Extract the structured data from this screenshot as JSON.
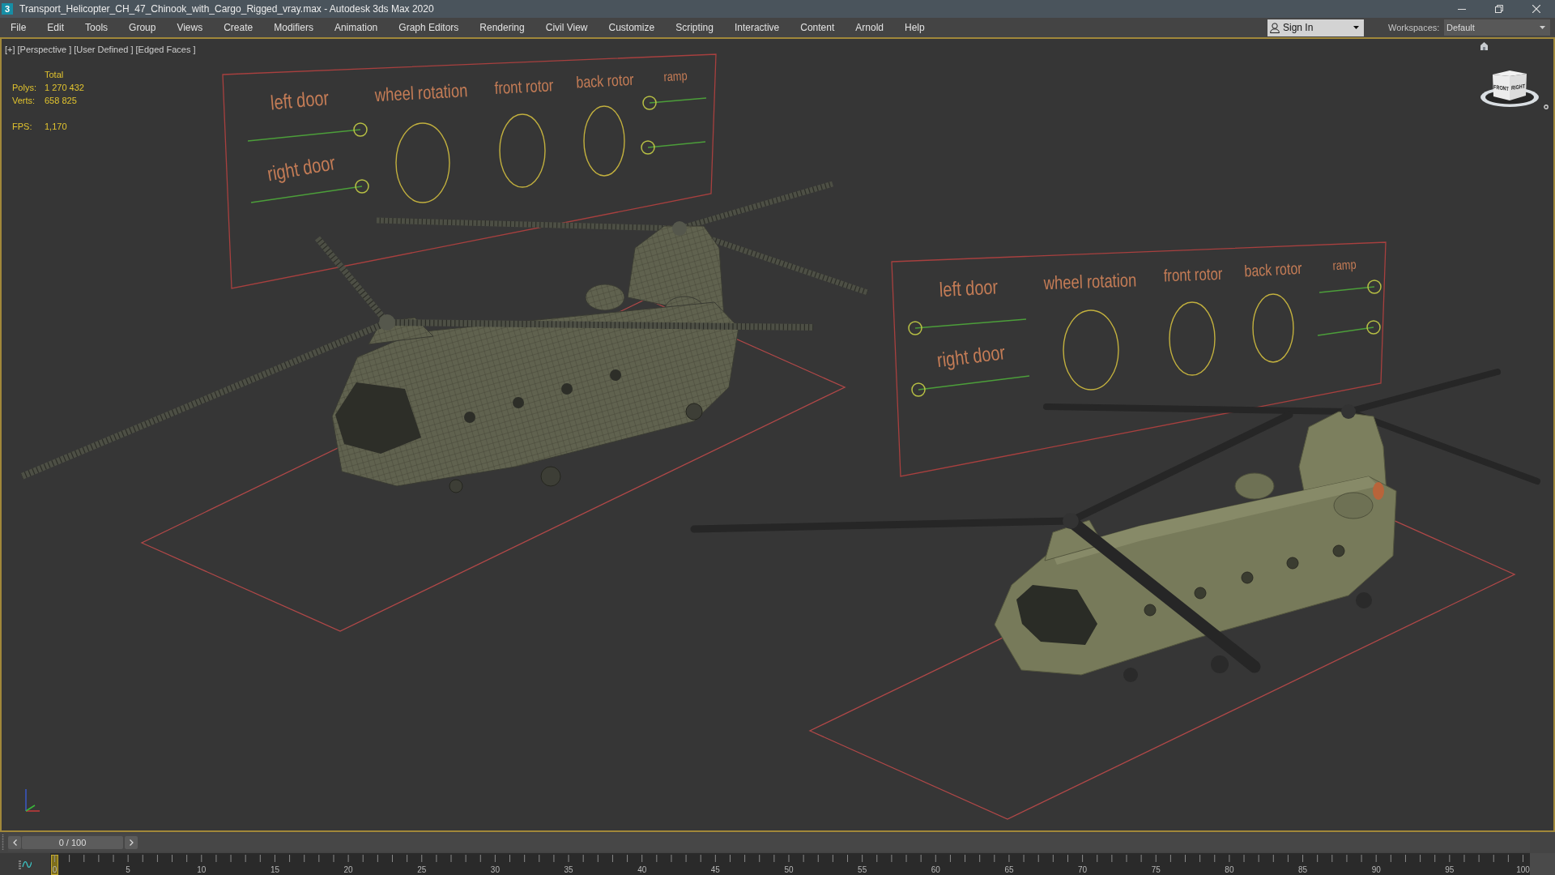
{
  "window": {
    "app_icon": "3",
    "title": "Transport_Helicopter_CH_47_Chinook_with_Cargo_Rigged_vray.max - Autodesk 3ds Max 2020"
  },
  "menu": [
    "File",
    "Edit",
    "Tools",
    "Group",
    "Views",
    "Create",
    "Modifiers",
    "Animation",
    "Graph Editors",
    "Rendering",
    "Civil View",
    "Customize",
    "Scripting",
    "Interactive",
    "Content",
    "Arnold",
    "Help"
  ],
  "account": {
    "label": "Sign In"
  },
  "workspaces": {
    "label": "Workspaces:",
    "value": "Default"
  },
  "viewport": {
    "labels": [
      "[+]",
      "[Perspective ]",
      "[User Defined ]",
      "[Edged Faces ]"
    ],
    "stats": {
      "header": "Total",
      "counts": [
        {
          "label": "Polys:",
          "value": "1 270 432"
        },
        {
          "label": "Verts:",
          "value": "658 825"
        }
      ],
      "fps": {
        "label": "FPS:",
        "value": "1,170"
      }
    },
    "rig_panels": [
      {
        "controls": [
          {
            "kind": "slider",
            "label": "left door",
            "level": 1
          },
          {
            "kind": "dial",
            "label": "wheel rotation"
          },
          {
            "kind": "dial",
            "label": "front rotor"
          },
          {
            "kind": "dial",
            "label": "back rotor"
          },
          {
            "kind": "slider",
            "label": "ramp",
            "level": 0
          },
          {
            "kind": "slider",
            "level": 0
          },
          {
            "kind": "slider",
            "label": "right door",
            "level": 1
          }
        ]
      },
      {
        "controls": [
          {
            "kind": "slider",
            "label": "left door",
            "level": 0
          },
          {
            "kind": "dial",
            "label": "wheel rotation"
          },
          {
            "kind": "dial",
            "label": "front rotor"
          },
          {
            "kind": "dial",
            "label": "back rotor"
          },
          {
            "kind": "slider",
            "label": "ramp",
            "level": 1
          },
          {
            "kind": "slider",
            "level": 1
          },
          {
            "kind": "slider",
            "label": "right door",
            "level": 0
          }
        ]
      }
    ],
    "view_cube": {
      "faces": [
        "FRONT",
        "RIGHT"
      ]
    }
  },
  "time_slider": {
    "label": "0 / 100",
    "level": 0
  },
  "timeline": {
    "ticks": [
      "0",
      "5",
      "10",
      "15",
      "20",
      "25",
      "30",
      "35",
      "40",
      "45",
      "50",
      "55",
      "60",
      "65",
      "70",
      "75",
      "80",
      "85",
      "90",
      "95",
      "100"
    ]
  }
}
